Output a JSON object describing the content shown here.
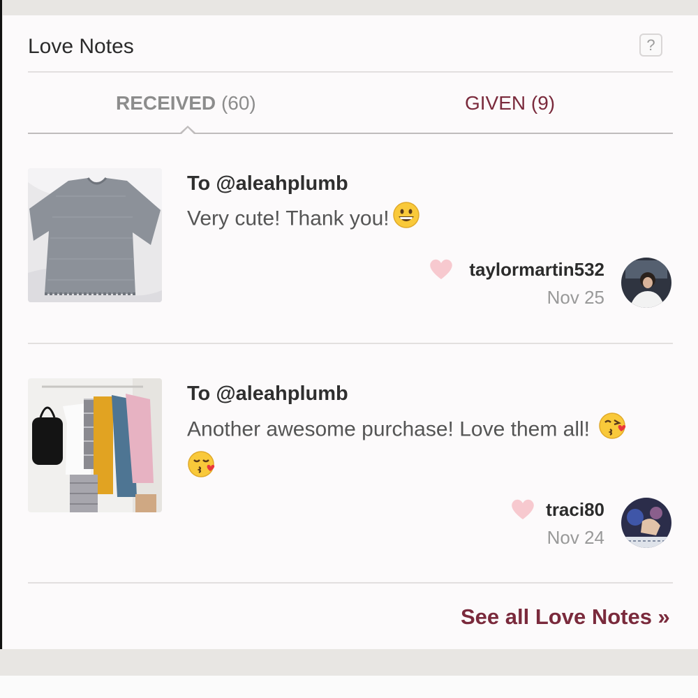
{
  "header": {
    "title": "Love Notes",
    "help_label": "?"
  },
  "tabs": [
    {
      "label": "RECEIVED",
      "count": "(60)",
      "active": true
    },
    {
      "label": "GIVEN (9)",
      "active": false
    }
  ],
  "notes": [
    {
      "to": "To @aleahplumb",
      "message": "Very cute! Thank you!",
      "emojis": [
        "grinning-face"
      ],
      "username": "taylormartin532",
      "date": "Nov 25",
      "image": "gray-ribbed-tshirt-photo",
      "avatar": "user-avatar-photo"
    },
    {
      "to": "To @aleahplumb",
      "message": "Another awesome purchase! Love them all!",
      "emojis": [
        "face-blowing-kiss",
        "kissing-face"
      ],
      "username": "traci80",
      "date": "Nov 24",
      "image": "clothing-rack-photo",
      "avatar": "user-avatar-photo"
    }
  ],
  "footer": {
    "see_all_label": "See all Love Notes »"
  },
  "colors": {
    "accent": "#7a2a3c",
    "heart": "#f7c9cf",
    "muted": "#8c8c8c"
  }
}
